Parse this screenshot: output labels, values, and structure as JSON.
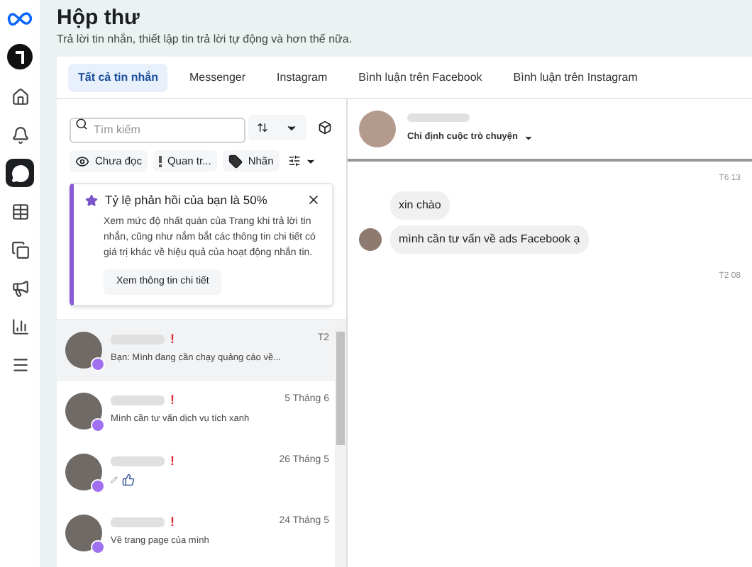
{
  "header": {
    "title": "Hộp thư",
    "subtitle": "Trả lời tin nhắn, thiết lập tin trả lời tự động và hơn thế nữa."
  },
  "sidebar": {
    "items": [
      {
        "kind": "home",
        "selected": false
      },
      {
        "kind": "bell",
        "selected": false
      },
      {
        "kind": "chat",
        "selected": true
      },
      {
        "kind": "table",
        "selected": false
      },
      {
        "kind": "pages",
        "selected": false
      },
      {
        "kind": "megaphone",
        "selected": false
      },
      {
        "kind": "chart",
        "selected": false
      },
      {
        "kind": "menu",
        "selected": false
      }
    ]
  },
  "tabs": [
    {
      "label": "Tất cả tin nhắn",
      "selected": true
    },
    {
      "label": "Messenger",
      "selected": false
    },
    {
      "label": "Instagram",
      "selected": false
    },
    {
      "label": "Bình luận trên Facebook",
      "selected": false
    },
    {
      "label": "Bình luận trên Instagram",
      "selected": false
    }
  ],
  "search": {
    "placeholder": "Tìm kiếm"
  },
  "filters": [
    {
      "kind": "eye",
      "label": "Chưa đọc"
    },
    {
      "kind": "important",
      "label": "Quan tr..."
    },
    {
      "kind": "tag",
      "label": "Nhãn"
    }
  ],
  "notice": {
    "title": "Tỷ lệ phản hồi của bạn là 50%",
    "body": "Xem mức độ nhất quán của Trang khi trả lời tin nhắn, cũng như nắm bắt các thông tin chi tiết có giá trị khác về hiệu quả của hoạt động nhắn tin.",
    "button": "Xem thông tin chi tiết"
  },
  "conversations": [
    {
      "kind": "text",
      "preview": "Bạn: Mình đang cần chạy quảng cáo về...",
      "flag": "!",
      "time": "T2",
      "selected": true
    },
    {
      "kind": "text",
      "preview": "Mình cần tư vấn dịch vụ tích xanh",
      "flag": "!",
      "time": "5 Tháng 6",
      "selected": false
    },
    {
      "kind": "like",
      "flag": "!",
      "time": "26 Tháng 5",
      "selected": false
    },
    {
      "kind": "text",
      "preview": "Về trang page của mình",
      "flag": "!",
      "time": "24 Tháng 5",
      "selected": false
    }
  ],
  "chat": {
    "assign": "Chỉ định cuộc trò chuyện",
    "messages": [
      {
        "kind": "time",
        "text": "T6 13"
      },
      {
        "kind": "message",
        "text": "xin chào",
        "avatar": false
      },
      {
        "kind": "message",
        "text": "mình cần tư vấn về ads Facebook ạ",
        "avatar": true
      },
      {
        "kind": "time",
        "text": "T2 08"
      }
    ]
  }
}
